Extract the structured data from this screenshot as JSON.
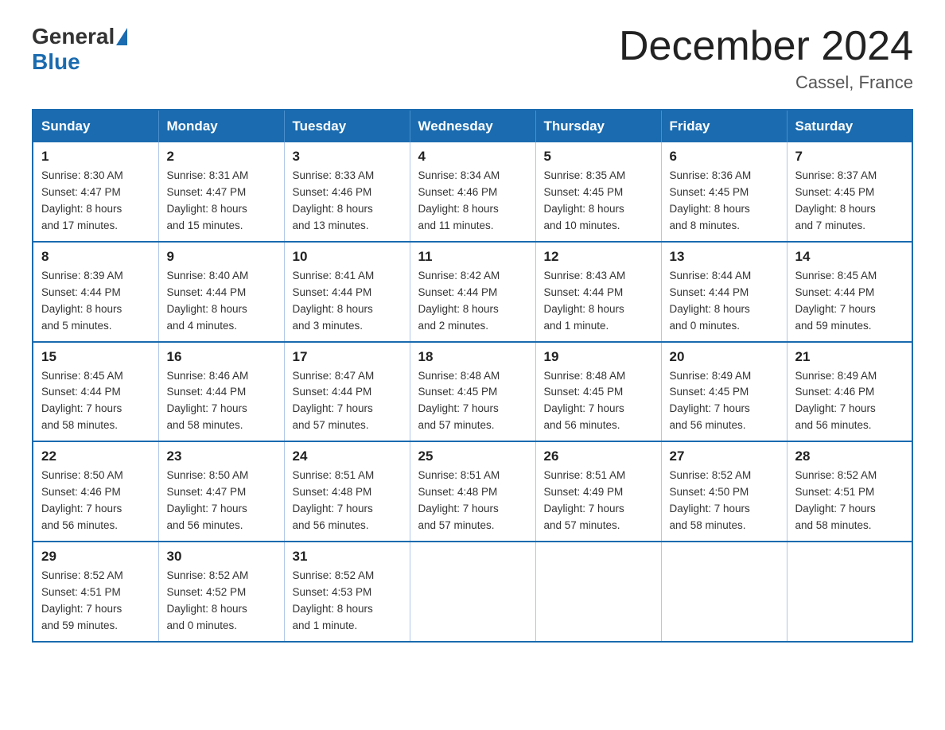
{
  "logo": {
    "general": "General",
    "blue": "Blue"
  },
  "title": "December 2024",
  "location": "Cassel, France",
  "headers": [
    "Sunday",
    "Monday",
    "Tuesday",
    "Wednesday",
    "Thursday",
    "Friday",
    "Saturday"
  ],
  "weeks": [
    [
      {
        "day": "1",
        "info": "Sunrise: 8:30 AM\nSunset: 4:47 PM\nDaylight: 8 hours\nand 17 minutes."
      },
      {
        "day": "2",
        "info": "Sunrise: 8:31 AM\nSunset: 4:47 PM\nDaylight: 8 hours\nand 15 minutes."
      },
      {
        "day": "3",
        "info": "Sunrise: 8:33 AM\nSunset: 4:46 PM\nDaylight: 8 hours\nand 13 minutes."
      },
      {
        "day": "4",
        "info": "Sunrise: 8:34 AM\nSunset: 4:46 PM\nDaylight: 8 hours\nand 11 minutes."
      },
      {
        "day": "5",
        "info": "Sunrise: 8:35 AM\nSunset: 4:45 PM\nDaylight: 8 hours\nand 10 minutes."
      },
      {
        "day": "6",
        "info": "Sunrise: 8:36 AM\nSunset: 4:45 PM\nDaylight: 8 hours\nand 8 minutes."
      },
      {
        "day": "7",
        "info": "Sunrise: 8:37 AM\nSunset: 4:45 PM\nDaylight: 8 hours\nand 7 minutes."
      }
    ],
    [
      {
        "day": "8",
        "info": "Sunrise: 8:39 AM\nSunset: 4:44 PM\nDaylight: 8 hours\nand 5 minutes."
      },
      {
        "day": "9",
        "info": "Sunrise: 8:40 AM\nSunset: 4:44 PM\nDaylight: 8 hours\nand 4 minutes."
      },
      {
        "day": "10",
        "info": "Sunrise: 8:41 AM\nSunset: 4:44 PM\nDaylight: 8 hours\nand 3 minutes."
      },
      {
        "day": "11",
        "info": "Sunrise: 8:42 AM\nSunset: 4:44 PM\nDaylight: 8 hours\nand 2 minutes."
      },
      {
        "day": "12",
        "info": "Sunrise: 8:43 AM\nSunset: 4:44 PM\nDaylight: 8 hours\nand 1 minute."
      },
      {
        "day": "13",
        "info": "Sunrise: 8:44 AM\nSunset: 4:44 PM\nDaylight: 8 hours\nand 0 minutes."
      },
      {
        "day": "14",
        "info": "Sunrise: 8:45 AM\nSunset: 4:44 PM\nDaylight: 7 hours\nand 59 minutes."
      }
    ],
    [
      {
        "day": "15",
        "info": "Sunrise: 8:45 AM\nSunset: 4:44 PM\nDaylight: 7 hours\nand 58 minutes."
      },
      {
        "day": "16",
        "info": "Sunrise: 8:46 AM\nSunset: 4:44 PM\nDaylight: 7 hours\nand 58 minutes."
      },
      {
        "day": "17",
        "info": "Sunrise: 8:47 AM\nSunset: 4:44 PM\nDaylight: 7 hours\nand 57 minutes."
      },
      {
        "day": "18",
        "info": "Sunrise: 8:48 AM\nSunset: 4:45 PM\nDaylight: 7 hours\nand 57 minutes."
      },
      {
        "day": "19",
        "info": "Sunrise: 8:48 AM\nSunset: 4:45 PM\nDaylight: 7 hours\nand 56 minutes."
      },
      {
        "day": "20",
        "info": "Sunrise: 8:49 AM\nSunset: 4:45 PM\nDaylight: 7 hours\nand 56 minutes."
      },
      {
        "day": "21",
        "info": "Sunrise: 8:49 AM\nSunset: 4:46 PM\nDaylight: 7 hours\nand 56 minutes."
      }
    ],
    [
      {
        "day": "22",
        "info": "Sunrise: 8:50 AM\nSunset: 4:46 PM\nDaylight: 7 hours\nand 56 minutes."
      },
      {
        "day": "23",
        "info": "Sunrise: 8:50 AM\nSunset: 4:47 PM\nDaylight: 7 hours\nand 56 minutes."
      },
      {
        "day": "24",
        "info": "Sunrise: 8:51 AM\nSunset: 4:48 PM\nDaylight: 7 hours\nand 56 minutes."
      },
      {
        "day": "25",
        "info": "Sunrise: 8:51 AM\nSunset: 4:48 PM\nDaylight: 7 hours\nand 57 minutes."
      },
      {
        "day": "26",
        "info": "Sunrise: 8:51 AM\nSunset: 4:49 PM\nDaylight: 7 hours\nand 57 minutes."
      },
      {
        "day": "27",
        "info": "Sunrise: 8:52 AM\nSunset: 4:50 PM\nDaylight: 7 hours\nand 58 minutes."
      },
      {
        "day": "28",
        "info": "Sunrise: 8:52 AM\nSunset: 4:51 PM\nDaylight: 7 hours\nand 58 minutes."
      }
    ],
    [
      {
        "day": "29",
        "info": "Sunrise: 8:52 AM\nSunset: 4:51 PM\nDaylight: 7 hours\nand 59 minutes."
      },
      {
        "day": "30",
        "info": "Sunrise: 8:52 AM\nSunset: 4:52 PM\nDaylight: 8 hours\nand 0 minutes."
      },
      {
        "day": "31",
        "info": "Sunrise: 8:52 AM\nSunset: 4:53 PM\nDaylight: 8 hours\nand 1 minute."
      },
      null,
      null,
      null,
      null
    ]
  ]
}
